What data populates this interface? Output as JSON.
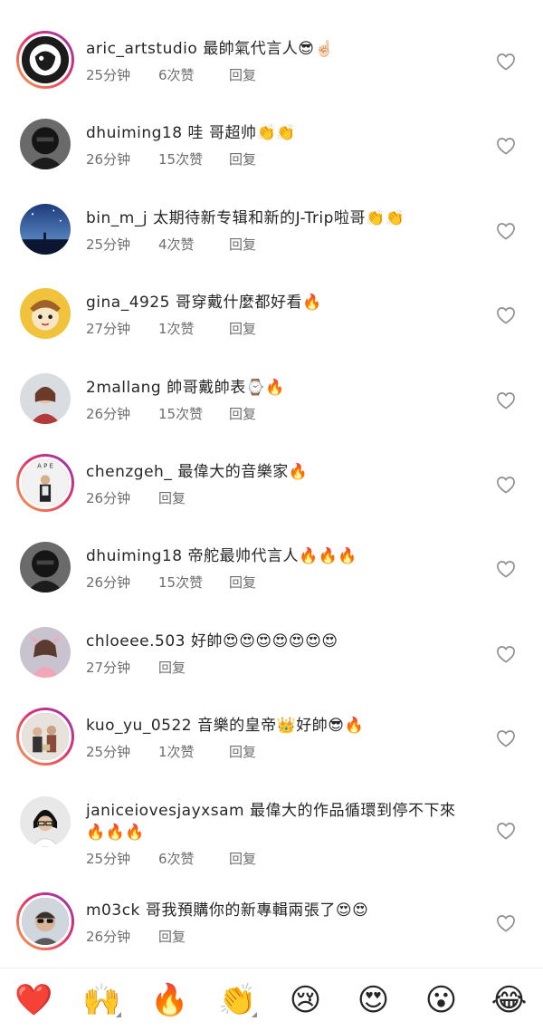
{
  "comments": [
    {
      "user": "aric_artstudio",
      "text": "最帥氣代言人😎☝🏻",
      "time": "25分钟",
      "likes": "6次赞",
      "reply": "回复",
      "story": true,
      "avatar": "logo-dark"
    },
    {
      "user": "dhuiming18",
      "text": "哇 哥超帅👏👏",
      "time": "26分钟",
      "likes": "15次赞",
      "reply": "回复",
      "story": false,
      "avatar": "masked-person"
    },
    {
      "user": "bin_m_j",
      "text": "太期待新专辑和新的J-Trip啦哥👏👏",
      "time": "25分钟",
      "likes": "4次赞",
      "reply": "回复",
      "story": false,
      "avatar": "night-sky"
    },
    {
      "user": "gina_4925",
      "text": "哥穿戴什麼都好看🔥",
      "time": "27分钟",
      "likes": "1次赞",
      "reply": "回复",
      "story": false,
      "avatar": "cartoon-yellow"
    },
    {
      "user": "2mallang",
      "text": "帥哥戴帥表⌚🔥",
      "time": "26分钟",
      "likes": "15次赞",
      "reply": "回复",
      "story": false,
      "avatar": "person-red"
    },
    {
      "user": "chenzgeh_",
      "text": "最偉大的音樂家🔥",
      "time": "26分钟",
      "likes": "",
      "reply": "回复",
      "story": true,
      "avatar": "person-standing"
    },
    {
      "user": "dhuiming18",
      "text": "帝舵最帅代言人🔥🔥🔥",
      "time": "26分钟",
      "likes": "15次赞",
      "reply": "回复",
      "story": false,
      "avatar": "masked-person"
    },
    {
      "user": "chloeee.503",
      "text": "好帥😍😍😍😍😍😍😍",
      "time": "27分钟",
      "likes": "",
      "reply": "回复",
      "story": false,
      "avatar": "person-pink"
    },
    {
      "user": "kuo_yu_0522",
      "text": "音樂的皇帝👑好帥😎🔥",
      "time": "25分钟",
      "likes": "1次赞",
      "reply": "回复",
      "story": true,
      "avatar": "group-photo"
    },
    {
      "user": "janiceiovesjayxsam",
      "text": "最偉大的作品循環到停不下來🔥🔥🔥",
      "time": "25分钟",
      "likes": "6次赞",
      "reply": "回复",
      "story": false,
      "avatar": "person-glasses"
    },
    {
      "user": "m03ck",
      "text": "哥我預購你的新專輯兩張了😍😍",
      "time": "26分钟",
      "likes": "",
      "reply": "回复",
      "story": true,
      "avatar": "man-sunglasses"
    }
  ],
  "reactions": [
    {
      "emoji": "❤️",
      "name": "heart"
    },
    {
      "emoji": "🙌",
      "name": "raised-hands"
    },
    {
      "emoji": "🔥",
      "name": "fire"
    },
    {
      "emoji": "👏",
      "name": "clap"
    },
    {
      "emoji": "😢",
      "name": "crying"
    },
    {
      "emoji": "😍",
      "name": "heart-eyes"
    },
    {
      "emoji": "😮",
      "name": "surprised"
    },
    {
      "emoji": "😂",
      "name": "laughing"
    }
  ],
  "colors": {
    "text": "#262626",
    "meta": "#6e6e6e",
    "heart_outline": "#8e8e8e",
    "story_ring_start": "#f9a54a",
    "story_ring_end": "#8a3ab9"
  }
}
